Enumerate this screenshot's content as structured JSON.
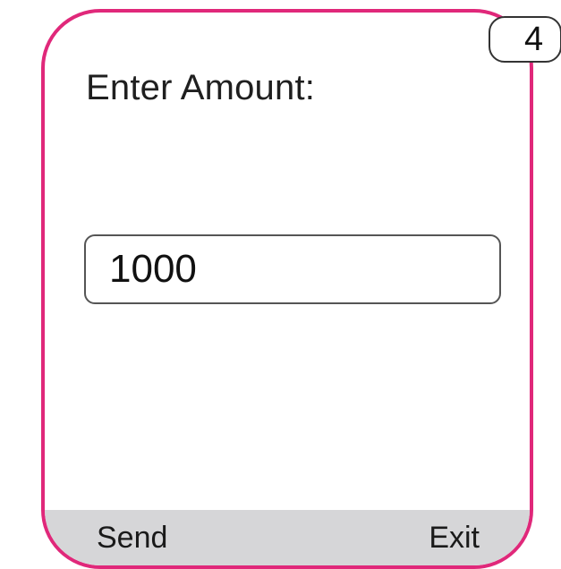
{
  "screen": {
    "prompt": "Enter Amount:",
    "amount_value": "1000"
  },
  "softkeys": {
    "left_label": "Send",
    "right_label": "Exit"
  },
  "key_indicator": "4",
  "colors": {
    "border_accent": "#e0287a",
    "softkey_bar": "#d6d6d8",
    "text": "#1f1f1f"
  }
}
